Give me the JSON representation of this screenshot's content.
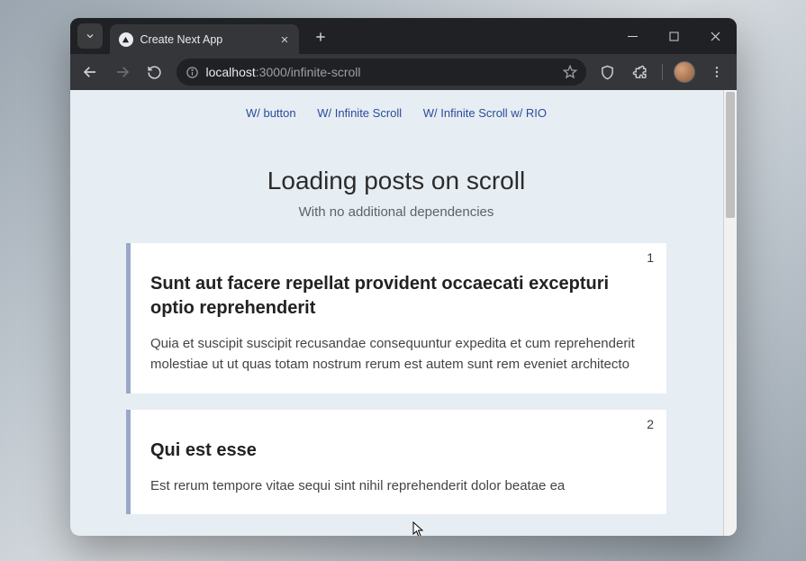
{
  "window": {
    "title": "Create Next App"
  },
  "toolbar": {
    "url_host": "localhost",
    "url_port_path": ":3000/infinite-scroll"
  },
  "page": {
    "nav": [
      {
        "label": "W/ button"
      },
      {
        "label": "W/ Infinite Scroll"
      },
      {
        "label": "W/ Infinite Scroll w/ RIO"
      }
    ],
    "title": "Loading posts on scroll",
    "subtitle": "With no additional dependencies",
    "posts": [
      {
        "num": "1",
        "title": "Sunt aut facere repellat provident occaecati excepturi optio reprehenderit",
        "body": "Quia et suscipit suscipit recusandae consequuntur expedita et cum reprehenderit molestiae ut ut quas totam nostrum rerum est autem sunt rem eveniet architecto"
      },
      {
        "num": "2",
        "title": "Qui est esse",
        "body": "Est rerum tempore vitae sequi sint nihil reprehenderit dolor beatae ea"
      }
    ]
  }
}
